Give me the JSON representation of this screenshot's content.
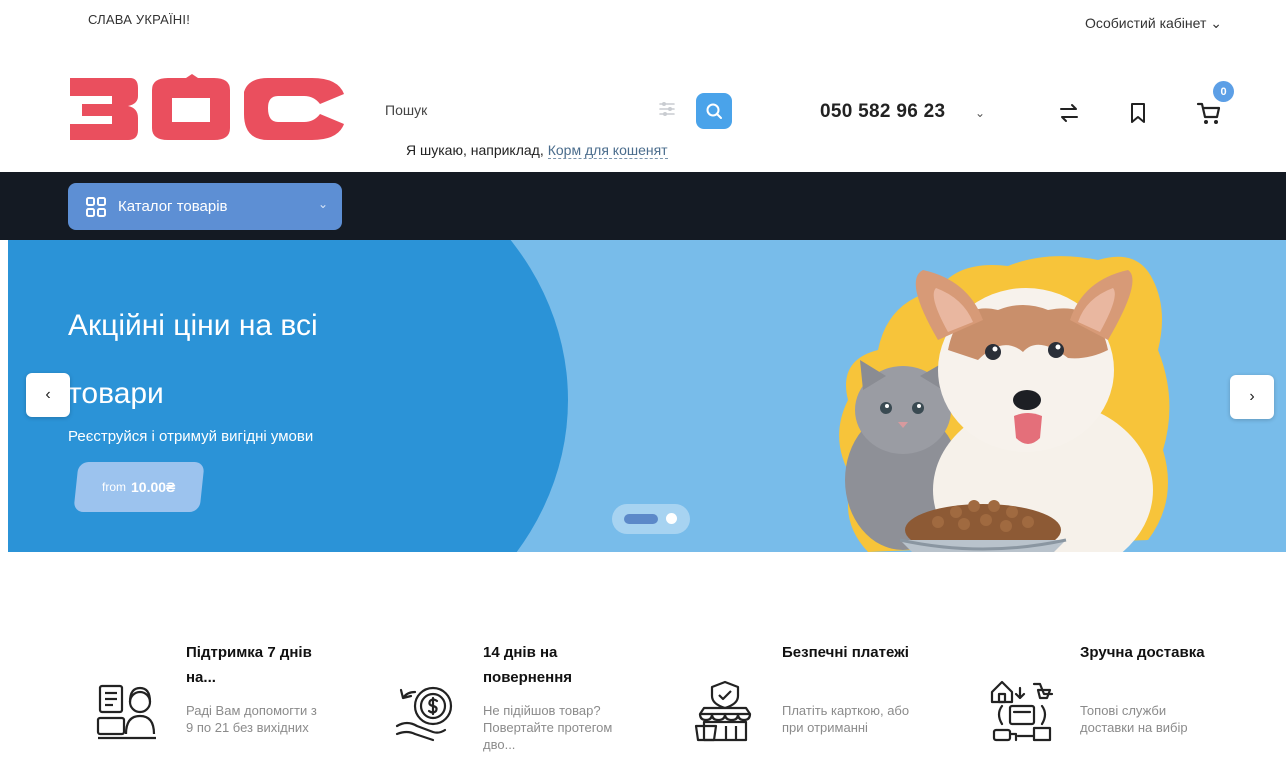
{
  "topbar": {
    "slogan": "СЛАВА УКРАЇНІ!",
    "account_label": "Особистий кабінет ⌄"
  },
  "header": {
    "logo_text": "ЗОС",
    "search": {
      "label": "Пошук",
      "hint_prefix": "Я шукаю, наприклад,",
      "hint_link": "Корм для кошенят"
    },
    "phone": "050 582 96 23",
    "cart_count": "0"
  },
  "nav": {
    "catalog_label": "Каталог товарів"
  },
  "hero": {
    "title": "Акційні ціни на всі товари",
    "subtitle": "Реєструйся і отримуй вигідні умови",
    "price_from": "from",
    "price_value": "10.00₴",
    "prev_symbol": "‹",
    "next_symbol": "›",
    "slides_total": 2,
    "slide_active": 1
  },
  "features": [
    {
      "title": "Підтримка 7 днів на...",
      "text": "Раді Вам допомогти з 9 по 21 без вихідних",
      "icon": "support-agent-icon"
    },
    {
      "title": "14 днів на повернення",
      "text": "Не підійшов товар? Повертайте протегом дво...",
      "icon": "money-return-icon"
    },
    {
      "title": "Безпечні платежі",
      "text": "Платіть карткою, або при отриманні",
      "icon": "secure-shop-icon"
    },
    {
      "title": "Зручна доставка",
      "text": "Топові служби доставки на вибір",
      "icon": "delivery-icon"
    }
  ],
  "colors": {
    "logo_red": "#ea4f5e",
    "accent_blue": "#4aa3ea",
    "nav_dark": "#141a23",
    "hero_light": "#78bcea",
    "hero_dark": "#2b93d7",
    "art_yellow": "#f7c43a"
  }
}
